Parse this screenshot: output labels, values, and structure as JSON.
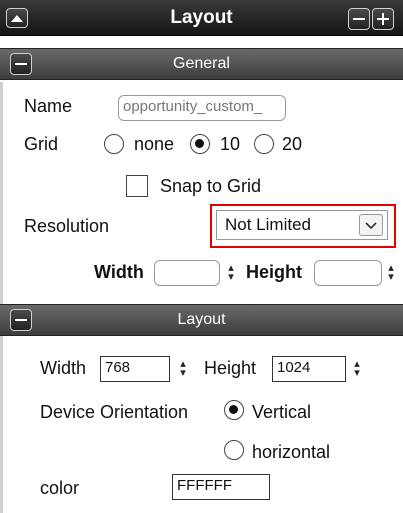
{
  "window": {
    "title": "Layout"
  },
  "general_section": {
    "label": "General",
    "name_label": "Name",
    "name_value": "opportunity_custom_",
    "grid_label": "Grid",
    "grid_options": [
      "none",
      "10",
      "20"
    ],
    "grid_selected": "10",
    "snap_label": "Snap to Grid",
    "resolution_label": "Resolution",
    "resolution_value": "Not Limited",
    "width_label": "Width",
    "height_label": "Height"
  },
  "layout_section": {
    "label": "Layout",
    "width_label": "Width",
    "width_value": "768",
    "height_label": "Height",
    "height_value": "1024",
    "orientation_label": "Device Orientation",
    "orientation_options": [
      "Vertical",
      "horizontal"
    ],
    "orientation_selected": "Vertical",
    "color_label": "color",
    "color_value": "FFFFFF"
  },
  "colors": {
    "highlight": "#e00000",
    "header_dark": "#1e1e1e",
    "section_gray": "#555555"
  }
}
